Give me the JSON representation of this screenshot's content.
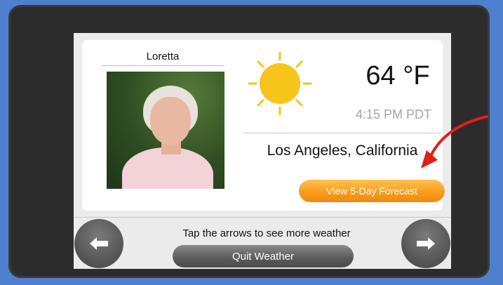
{
  "profile": {
    "name": "Loretta"
  },
  "weather": {
    "temperature": "64 °F",
    "time": "4:15 PM PDT",
    "location": "Los Angeles, California",
    "condition_icon": "sun-icon",
    "forecast_button_label": "View 5-Day Forecast"
  },
  "footer": {
    "hint": "Tap the arrows to see more weather",
    "quit_label": "Quit Weather"
  },
  "colors": {
    "background": "#4f7fcf",
    "device_frame": "#2c2c2c",
    "sun": "#f6c41a",
    "forecast_button": "#f79a1b",
    "annotation_arrow": "#e0201b"
  }
}
